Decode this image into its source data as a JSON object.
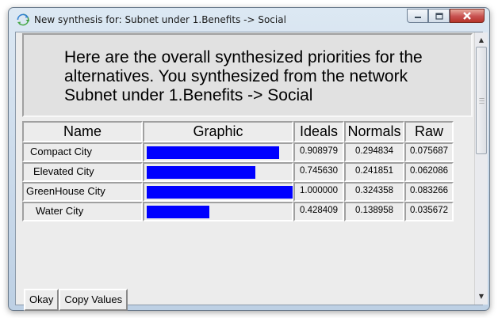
{
  "window": {
    "title": "New synthesis for: Subnet under 1.Benefits -> Social",
    "app_icon": "refresh-sync-icon",
    "caption_buttons": [
      "minimize-icon",
      "maximize-icon",
      "close-icon"
    ]
  },
  "message": {
    "line1": "Here are the overall synthesized priorities for the",
    "line2": "alternatives.  You synthesized from the network",
    "line3": "Subnet under 1.Benefits -> Social"
  },
  "table": {
    "headers": {
      "name": "Name",
      "graphic": "Graphic",
      "ideals": "Ideals",
      "normals": "Normals",
      "raw": "Raw"
    },
    "rows": [
      {
        "name": "Compact City",
        "ideals": "0.908979",
        "normals": "0.294834",
        "raw": "0.075687",
        "bar_fraction": 0.908979
      },
      {
        "name": "Elevated City",
        "ideals": "0.745630",
        "normals": "0.241851",
        "raw": "0.062086",
        "bar_fraction": 0.74563
      },
      {
        "name": "GreenHouse City",
        "ideals": "1.000000",
        "normals": "0.324358",
        "raw": "0.083266",
        "bar_fraction": 1.0
      },
      {
        "name": "Water City",
        "ideals": "0.428409",
        "normals": "0.138958",
        "raw": "0.035672",
        "bar_fraction": 0.428409
      }
    ]
  },
  "buttons": {
    "okay": "Okay",
    "copy_values": "Copy Values"
  },
  "colors": {
    "bar": "#0000ff",
    "close_button": "#c75050"
  }
}
